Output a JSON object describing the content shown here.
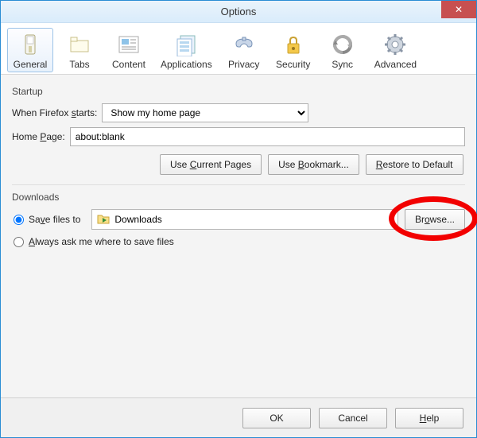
{
  "window": {
    "title": "Options"
  },
  "toolbar": [
    {
      "name": "general",
      "label": "General",
      "selected": true
    },
    {
      "name": "tabs",
      "label": "Tabs"
    },
    {
      "name": "content",
      "label": "Content"
    },
    {
      "name": "applications",
      "label": "Applications"
    },
    {
      "name": "privacy",
      "label": "Privacy"
    },
    {
      "name": "security",
      "label": "Security"
    },
    {
      "name": "sync",
      "label": "Sync"
    },
    {
      "name": "advanced",
      "label": "Advanced"
    }
  ],
  "startup": {
    "group_label": "Startup",
    "when_starts_label_pre": "When Firefox ",
    "when_starts_underline": "s",
    "when_starts_label_post": "tarts:",
    "when_starts_value": "Show my home page",
    "home_page_label_pre": "Home ",
    "home_page_underline": "P",
    "home_page_label_post": "age:",
    "home_page_value": "about:blank",
    "use_current_pre": "Use ",
    "use_current_u": "C",
    "use_current_post": "urrent Pages",
    "use_bookmark_pre": "Use ",
    "use_bookmark_u": "B",
    "use_bookmark_post": "ookmark...",
    "restore_u": "R",
    "restore_post": "estore to Default"
  },
  "downloads": {
    "group_label": "Downloads",
    "save_files_pre": "Sa",
    "save_files_u": "v",
    "save_files_post": "e files to",
    "save_path": "Downloads",
    "browse_pre": "Br",
    "browse_u": "o",
    "browse_post": "wse...",
    "always_ask_pre": "",
    "always_ask_u": "A",
    "always_ask_post": "lways ask me where to save files"
  },
  "footer": {
    "ok": "OK",
    "cancel": "Cancel",
    "help_u": "H",
    "help_post": "elp"
  }
}
